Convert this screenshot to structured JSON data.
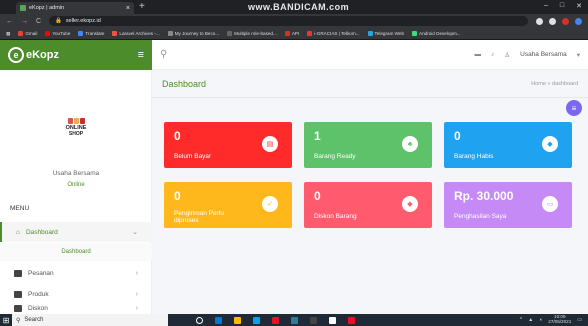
{
  "browser": {
    "tab_title": "eKopz | admin",
    "tab_close": "×",
    "new_tab": "+",
    "recorder_watermark": "www.BANDICAM.com",
    "url": "seller.ekopz.id",
    "window_controls": [
      "–",
      "□",
      "✕"
    ],
    "bookmarks": [
      {
        "label": "Gmail",
        "color": "#ea4335"
      },
      {
        "label": "YouTube",
        "color": "#ff0000"
      },
      {
        "label": "Translate",
        "color": "#4285f4"
      },
      {
        "label": "Laravel Archives -...",
        "color": "#f05340"
      },
      {
        "label": "My Journey to Beco...",
        "color": "#888888"
      },
      {
        "label": "Multiple role-based...",
        "color": "#666666"
      },
      {
        "label": "API",
        "color": "#d93025"
      },
      {
        "label": "i-GRACIAS | Telkom...",
        "color": "#e53935"
      },
      {
        "label": "Telegram Web",
        "color": "#2aa3df"
      },
      {
        "label": "Android Developm...",
        "color": "#3ddc84"
      }
    ]
  },
  "brand": {
    "logo_letter": "e",
    "name": "eKopz",
    "menu_icon": "≡"
  },
  "topbar": {
    "search_icon": "⚲",
    "user_name": "Usaha Bersama",
    "user_caret": "▾"
  },
  "sidebar": {
    "avatar_text_1": "ONLINE",
    "avatar_text_2": "SHOP",
    "user_name": "Usaha Bersama",
    "status": "Online",
    "menu_header": "MENU",
    "items": [
      {
        "label": "Dashboard",
        "chevron": "⌄"
      },
      {
        "label": "Pesanan",
        "chevron": "›"
      },
      {
        "label": "Produk",
        "chevron": "›"
      },
      {
        "label": "Diskon",
        "chevron": "›"
      }
    ],
    "submenu": "Dashboard"
  },
  "content": {
    "title": "Dashboard",
    "breadcrumb": "Home » dashboard",
    "fab_icon": "≡"
  },
  "cards": [
    {
      "value": "0",
      "label": "Belum Bayar",
      "color": "#ff2a2a",
      "icon": "▤",
      "icon_color": "#ff2a2a"
    },
    {
      "value": "1",
      "label": "Barang Ready",
      "color": "#5ec26a",
      "icon": "♣",
      "icon_color": "#5ec26a"
    },
    {
      "value": "0",
      "label": "Barang Habis",
      "color": "#1fa3f0",
      "icon": "◆",
      "icon_color": "#1fa3f0"
    },
    {
      "value": "0",
      "label": "Pengiriman Perlu diproses",
      "color": "#ffb81c",
      "icon": "✓",
      "icon_color": "#ffb81c"
    },
    {
      "value": "0",
      "label": "Diskon Barang",
      "color": "#ff5a6e",
      "icon": "◆",
      "icon_color": "#ff5a6e"
    },
    {
      "value": "Rp. 30.000",
      "label": "Penghasilan Saya",
      "color": "#c58af5",
      "icon": "▭",
      "icon_color": "#c58af5"
    }
  ],
  "taskbar": {
    "start_icon": "⊞",
    "search_placeholder": "Search",
    "app_colors": [
      "#ffffff",
      "#0078d7",
      "#ffb900",
      "#00a4ef",
      "#e81123",
      "#2d7d9a",
      "#444444",
      "#ffffff",
      "#e81123"
    ],
    "clock_time": "10:09",
    "clock_date": "27/05/2021"
  }
}
